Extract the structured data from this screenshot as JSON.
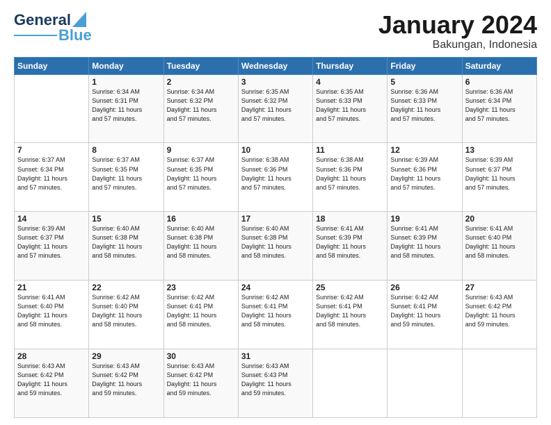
{
  "logo": {
    "text1": "General",
    "text2": "Blue"
  },
  "title": "January 2024",
  "subtitle": "Bakungan, Indonesia",
  "days_of_week": [
    "Sunday",
    "Monday",
    "Tuesday",
    "Wednesday",
    "Thursday",
    "Friday",
    "Saturday"
  ],
  "weeks": [
    [
      {
        "day": "",
        "info": ""
      },
      {
        "day": "1",
        "info": "Sunrise: 6:34 AM\nSunset: 6:31 PM\nDaylight: 11 hours\nand 57 minutes."
      },
      {
        "day": "2",
        "info": "Sunrise: 6:34 AM\nSunset: 6:32 PM\nDaylight: 11 hours\nand 57 minutes."
      },
      {
        "day": "3",
        "info": "Sunrise: 6:35 AM\nSunset: 6:32 PM\nDaylight: 11 hours\nand 57 minutes."
      },
      {
        "day": "4",
        "info": "Sunrise: 6:35 AM\nSunset: 6:33 PM\nDaylight: 11 hours\nand 57 minutes."
      },
      {
        "day": "5",
        "info": "Sunrise: 6:36 AM\nSunset: 6:33 PM\nDaylight: 11 hours\nand 57 minutes."
      },
      {
        "day": "6",
        "info": "Sunrise: 6:36 AM\nSunset: 6:34 PM\nDaylight: 11 hours\nand 57 minutes."
      }
    ],
    [
      {
        "day": "7",
        "info": "Sunrise: 6:37 AM\nSunset: 6:34 PM\nDaylight: 11 hours\nand 57 minutes."
      },
      {
        "day": "8",
        "info": "Sunrise: 6:37 AM\nSunset: 6:35 PM\nDaylight: 11 hours\nand 57 minutes."
      },
      {
        "day": "9",
        "info": "Sunrise: 6:37 AM\nSunset: 6:35 PM\nDaylight: 11 hours\nand 57 minutes."
      },
      {
        "day": "10",
        "info": "Sunrise: 6:38 AM\nSunset: 6:36 PM\nDaylight: 11 hours\nand 57 minutes."
      },
      {
        "day": "11",
        "info": "Sunrise: 6:38 AM\nSunset: 6:36 PM\nDaylight: 11 hours\nand 57 minutes."
      },
      {
        "day": "12",
        "info": "Sunrise: 6:39 AM\nSunset: 6:36 PM\nDaylight: 11 hours\nand 57 minutes."
      },
      {
        "day": "13",
        "info": "Sunrise: 6:39 AM\nSunset: 6:37 PM\nDaylight: 11 hours\nand 57 minutes."
      }
    ],
    [
      {
        "day": "14",
        "info": "Sunrise: 6:39 AM\nSunset: 6:37 PM\nDaylight: 11 hours\nand 57 minutes."
      },
      {
        "day": "15",
        "info": "Sunrise: 6:40 AM\nSunset: 6:38 PM\nDaylight: 11 hours\nand 58 minutes."
      },
      {
        "day": "16",
        "info": "Sunrise: 6:40 AM\nSunset: 6:38 PM\nDaylight: 11 hours\nand 58 minutes."
      },
      {
        "day": "17",
        "info": "Sunrise: 6:40 AM\nSunset: 6:38 PM\nDaylight: 11 hours\nand 58 minutes."
      },
      {
        "day": "18",
        "info": "Sunrise: 6:41 AM\nSunset: 6:39 PM\nDaylight: 11 hours\nand 58 minutes."
      },
      {
        "day": "19",
        "info": "Sunrise: 6:41 AM\nSunset: 6:39 PM\nDaylight: 11 hours\nand 58 minutes."
      },
      {
        "day": "20",
        "info": "Sunrise: 6:41 AM\nSunset: 6:40 PM\nDaylight: 11 hours\nand 58 minutes."
      }
    ],
    [
      {
        "day": "21",
        "info": "Sunrise: 6:41 AM\nSunset: 6:40 PM\nDaylight: 11 hours\nand 58 minutes."
      },
      {
        "day": "22",
        "info": "Sunrise: 6:42 AM\nSunset: 6:40 PM\nDaylight: 11 hours\nand 58 minutes."
      },
      {
        "day": "23",
        "info": "Sunrise: 6:42 AM\nSunset: 6:41 PM\nDaylight: 11 hours\nand 58 minutes."
      },
      {
        "day": "24",
        "info": "Sunrise: 6:42 AM\nSunset: 6:41 PM\nDaylight: 11 hours\nand 58 minutes."
      },
      {
        "day": "25",
        "info": "Sunrise: 6:42 AM\nSunset: 6:41 PM\nDaylight: 11 hours\nand 58 minutes."
      },
      {
        "day": "26",
        "info": "Sunrise: 6:42 AM\nSunset: 6:41 PM\nDaylight: 11 hours\nand 59 minutes."
      },
      {
        "day": "27",
        "info": "Sunrise: 6:43 AM\nSunset: 6:42 PM\nDaylight: 11 hours\nand 59 minutes."
      }
    ],
    [
      {
        "day": "28",
        "info": "Sunrise: 6:43 AM\nSunset: 6:42 PM\nDaylight: 11 hours\nand 59 minutes."
      },
      {
        "day": "29",
        "info": "Sunrise: 6:43 AM\nSunset: 6:42 PM\nDaylight: 11 hours\nand 59 minutes."
      },
      {
        "day": "30",
        "info": "Sunrise: 6:43 AM\nSunset: 6:42 PM\nDaylight: 11 hours\nand 59 minutes."
      },
      {
        "day": "31",
        "info": "Sunrise: 6:43 AM\nSunset: 6:43 PM\nDaylight: 11 hours\nand 59 minutes."
      },
      {
        "day": "",
        "info": ""
      },
      {
        "day": "",
        "info": ""
      },
      {
        "day": "",
        "info": ""
      }
    ]
  ]
}
